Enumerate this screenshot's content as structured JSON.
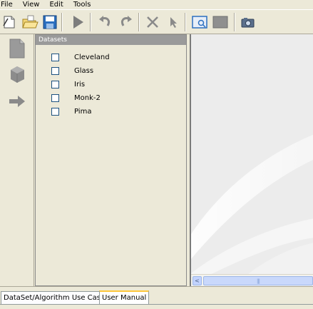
{
  "menu": {
    "file": "File",
    "view": "View",
    "edit": "Edit",
    "tools": "Tools"
  },
  "toolbar": {
    "icons": [
      "new-file-icon",
      "open-folder-icon",
      "save-disk-icon",
      "run-play-icon",
      "undo-icon",
      "redo-icon",
      "delete-x-icon",
      "pointer-arrow-icon",
      "zoom-view-icon",
      "grey-rectangle-icon",
      "camera-snapshot-icon"
    ]
  },
  "left_icons": [
    "document-icon",
    "cube-icon",
    "arrow-right-icon"
  ],
  "datasets": {
    "header": "Datasets",
    "items": [
      {
        "label": "Cleveland",
        "checked": false
      },
      {
        "label": "Glass",
        "checked": false
      },
      {
        "label": "Iris",
        "checked": false
      },
      {
        "label": "Monk-2",
        "checked": false
      },
      {
        "label": "Pima",
        "checked": false
      }
    ]
  },
  "scrollbar": {
    "left_arrow": "<",
    "thumb_grip": "|||"
  },
  "tabs": [
    {
      "label": "DataSet/Algorithm Use Case",
      "active": false
    },
    {
      "label": "User Manual",
      "active": true
    }
  ],
  "colors": {
    "background": "#ece9d8",
    "panel_header": "#9a9a9a",
    "active_tab_accent": "#ffc83c",
    "toolbar_blue": "#2b6fbf"
  }
}
